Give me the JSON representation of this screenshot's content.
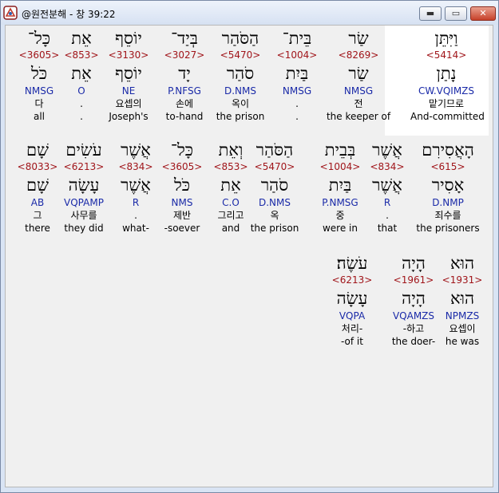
{
  "window": {
    "title": "@원전분해 - 창 39:22",
    "minimize_glyph": "▬",
    "maximize_glyph": "▭",
    "close_glyph": "✕",
    "icon": "app-icon"
  },
  "rows": [
    {
      "words": [
        {
          "heb": "וַיִּתֵּן",
          "strong": "<5414>",
          "lemma": "נָתַן",
          "parse": "CW.VQIMZS",
          "kor": "맡기므로",
          "eng": "And-committed",
          "highlighted": true
        },
        {
          "heb": "שַׂר",
          "strong": "<8269>",
          "lemma": "שַׂר",
          "parse": "NMSG",
          "kor": "전",
          "eng": "the keeper of"
        },
        {
          "heb": "בֵּית־",
          "strong": "<1004>",
          "lemma": "בַּיִת",
          "parse": "NMSG",
          "kor": ".",
          "eng": "."
        },
        {
          "heb": "הַסֹּהַר",
          "strong": "<5470>",
          "lemma": "סֹהַר",
          "parse": "D.NMS",
          "kor": "옥이",
          "eng": "the prison"
        },
        {
          "heb": "בְּיַד־",
          "strong": "<3027>",
          "lemma": "יָד",
          "parse": "P.NFSG",
          "kor": "손에",
          "eng": "to-hand"
        },
        {
          "heb": "יוֹסֵף",
          "strong": "<3130>",
          "lemma": "יוֹסֵף",
          "parse": "NE",
          "kor": "요셉의",
          "eng": "Joseph's"
        },
        {
          "heb": "אֵת",
          "strong": "<853>",
          "lemma": "אֵת",
          "parse": "O",
          "kor": ".",
          "eng": "."
        },
        {
          "heb": "כָּל־",
          "strong": "<3605>",
          "lemma": "כֹּל",
          "parse": "NMSG",
          "kor": "다",
          "eng": "all"
        }
      ]
    },
    {
      "words": [
        {
          "heb": "הָאֲסִירִם",
          "strong": "<615>",
          "lemma": "אָסִיר",
          "parse": "D.NMP",
          "kor": "죄수를",
          "eng": "the prisoners"
        },
        {
          "heb": "אֲשֶׁר",
          "strong": "<834>",
          "lemma": "אֲשֶׁר",
          "parse": "R",
          "kor": ".",
          "eng": "that"
        },
        {
          "heb": "בְּבֵית",
          "strong": "<1004>",
          "lemma": "בַּיִת",
          "parse": "P.NMSG",
          "kor": "중",
          "eng": "were in"
        },
        {
          "heb": "הַסֹּהַר",
          "strong": "<5470>",
          "lemma": "סֹהַר",
          "parse": "D.NMS",
          "kor": "옥",
          "eng": "the prison"
        },
        {
          "heb": "וְאֵת",
          "strong": "<853>",
          "lemma": "אֵת",
          "parse": "C.O",
          "kor": "그리고",
          "eng": "and"
        },
        {
          "heb": "כָּל־",
          "strong": "<3605>",
          "lemma": "כֹּל",
          "parse": "NMS",
          "kor": "제반",
          "eng": "-soever"
        },
        {
          "heb": "אֲשֶׁר",
          "strong": "<834>",
          "lemma": "אֲשֶׁר",
          "parse": "R",
          "kor": ".",
          "eng": "what-"
        },
        {
          "heb": "עֹשִׂים",
          "strong": "<6213>",
          "lemma": "עָשָׂה",
          "parse": "VQPAMP",
          "kor": "사무를",
          "eng": "they did"
        },
        {
          "heb": "שָׁם",
          "strong": "<8033>",
          "lemma": "שָׁם",
          "parse": "AB",
          "kor": "그",
          "eng": "there"
        }
      ]
    },
    {
      "words": [
        {
          "heb": "הוּא",
          "strong": "<1931>",
          "lemma": "הוּא",
          "parse": "NPMZS",
          "kor": "요셉이",
          "eng": "he was"
        },
        {
          "heb": "הָיָה",
          "strong": "<1961>",
          "lemma": "הָיָה",
          "parse": "VQAMZS",
          "kor": "-하고",
          "eng": "the doer-"
        },
        {
          "heb": "עֹשֶׂה׃",
          "strong": "<6213>",
          "lemma": "עָשָׂה",
          "parse": "VQPA",
          "kor": "처리-",
          "eng": "-of it"
        }
      ]
    }
  ]
}
